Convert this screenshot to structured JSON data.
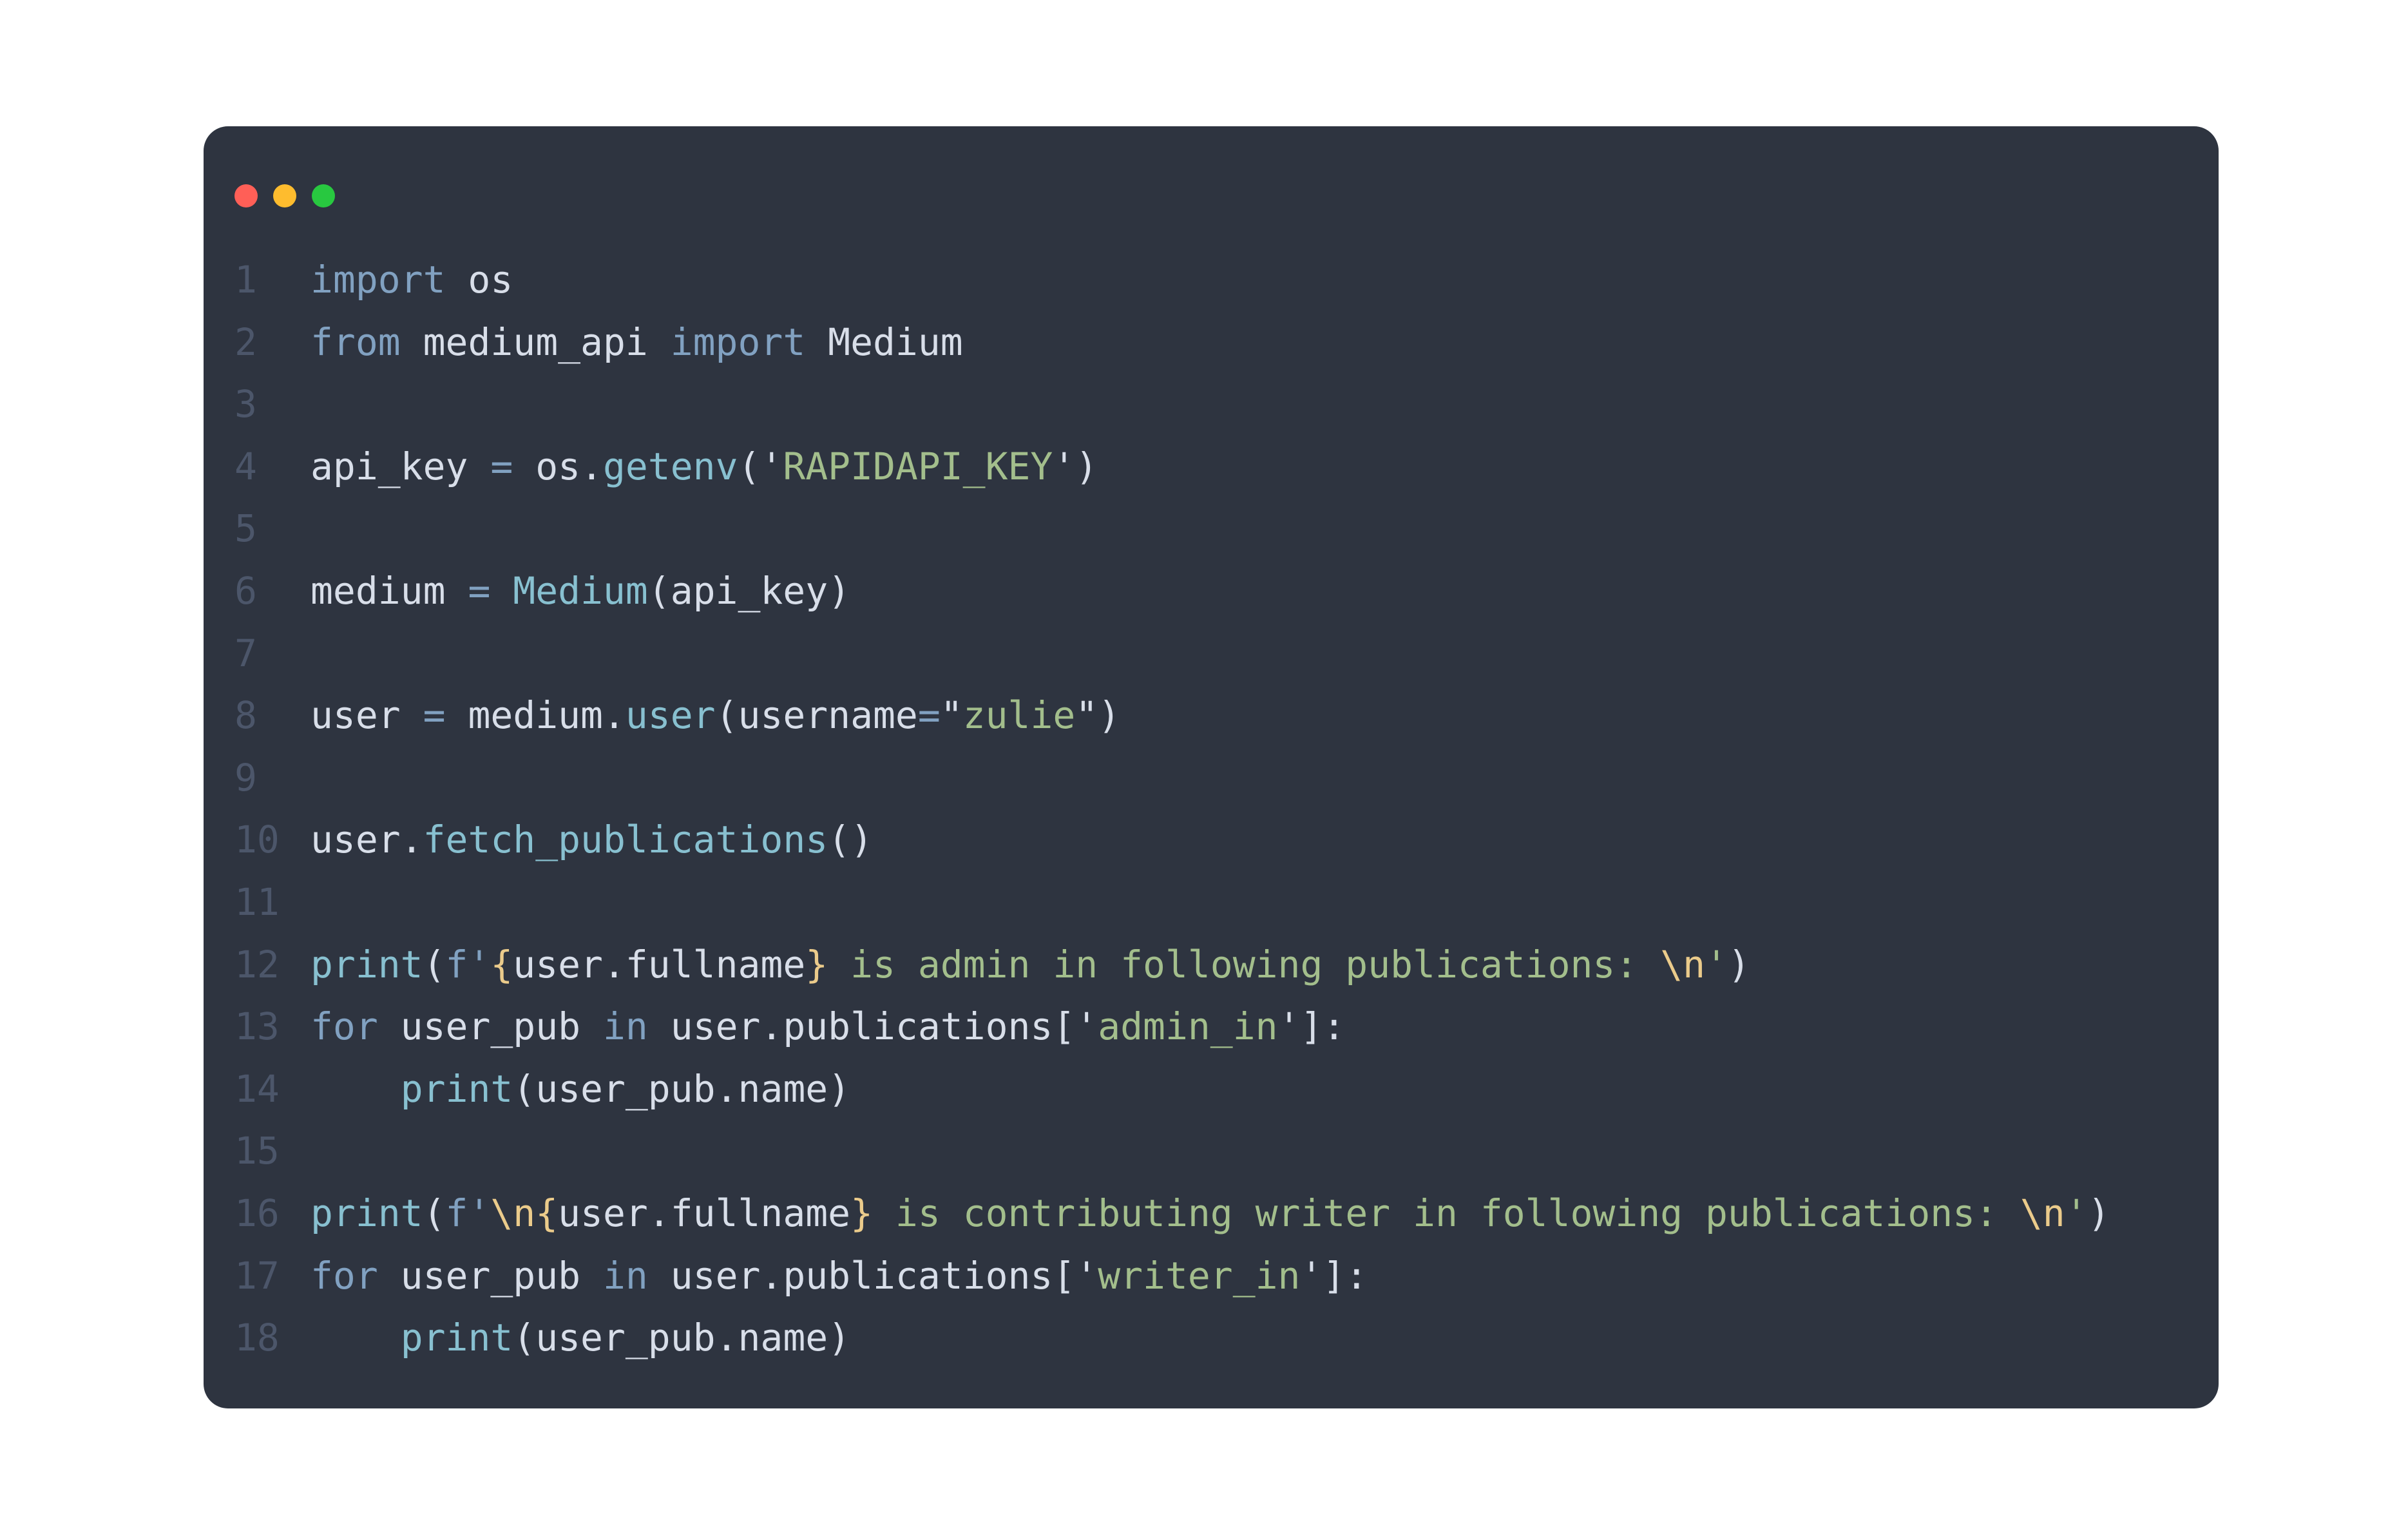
{
  "window": {
    "controls": [
      {
        "name": "close-dot",
        "color": "#ff5f57"
      },
      {
        "name": "minimize-dot",
        "color": "#febc2e"
      },
      {
        "name": "maximize-dot",
        "color": "#28c840"
      }
    ]
  },
  "code": {
    "language": "python",
    "colors": {
      "background": "#2e3440",
      "keyword": "#81a1c1",
      "function": "#88c0d0",
      "string": "#a3be8c",
      "escape": "#ebcb8b",
      "plain": "#d8dee9",
      "line_number": "#4c566a"
    },
    "lines": [
      {
        "number": "1",
        "tokens": [
          {
            "t": "kw",
            "v": "import"
          },
          {
            "t": "plain",
            "v": " os"
          }
        ]
      },
      {
        "number": "2",
        "tokens": [
          {
            "t": "kw",
            "v": "from"
          },
          {
            "t": "plain",
            "v": " medium_api "
          },
          {
            "t": "kw",
            "v": "import"
          },
          {
            "t": "plain",
            "v": " Medium"
          }
        ]
      },
      {
        "number": "3",
        "tokens": []
      },
      {
        "number": "4",
        "tokens": [
          {
            "t": "plain",
            "v": "api_key "
          },
          {
            "t": "op",
            "v": "="
          },
          {
            "t": "plain",
            "v": " os."
          },
          {
            "t": "fn",
            "v": "getenv"
          },
          {
            "t": "plain",
            "v": "('"
          },
          {
            "t": "str",
            "v": "RAPIDAPI_KEY"
          },
          {
            "t": "plain",
            "v": "')"
          }
        ]
      },
      {
        "number": "5",
        "tokens": []
      },
      {
        "number": "6",
        "tokens": [
          {
            "t": "plain",
            "v": "medium "
          },
          {
            "t": "op",
            "v": "="
          },
          {
            "t": "plain",
            "v": " "
          },
          {
            "t": "fn",
            "v": "Medium"
          },
          {
            "t": "plain",
            "v": "(api_key)"
          }
        ]
      },
      {
        "number": "7",
        "tokens": []
      },
      {
        "number": "8",
        "tokens": [
          {
            "t": "plain",
            "v": "user "
          },
          {
            "t": "op",
            "v": "="
          },
          {
            "t": "plain",
            "v": " medium."
          },
          {
            "t": "fn",
            "v": "user"
          },
          {
            "t": "plain",
            "v": "(username"
          },
          {
            "t": "op",
            "v": "="
          },
          {
            "t": "plain",
            "v": "\""
          },
          {
            "t": "str",
            "v": "zulie"
          },
          {
            "t": "plain",
            "v": "\")"
          }
        ]
      },
      {
        "number": "9",
        "tokens": []
      },
      {
        "number": "10",
        "tokens": [
          {
            "t": "plain",
            "v": "user."
          },
          {
            "t": "fn",
            "v": "fetch_publications"
          },
          {
            "t": "plain",
            "v": "()"
          }
        ]
      },
      {
        "number": "11",
        "tokens": []
      },
      {
        "number": "12",
        "tokens": [
          {
            "t": "fn",
            "v": "print"
          },
          {
            "t": "plain",
            "v": "("
          },
          {
            "t": "kw",
            "v": "f'"
          },
          {
            "t": "brace",
            "v": "{"
          },
          {
            "t": "plain",
            "v": "user.fullname"
          },
          {
            "t": "brace",
            "v": "}"
          },
          {
            "t": "str",
            "v": " is admin in following publications: "
          },
          {
            "t": "esc",
            "v": "\\n"
          },
          {
            "t": "str",
            "v": "'"
          },
          {
            "t": "plain",
            "v": ")"
          }
        ]
      },
      {
        "number": "13",
        "tokens": [
          {
            "t": "kw",
            "v": "for"
          },
          {
            "t": "plain",
            "v": " user_pub "
          },
          {
            "t": "kw",
            "v": "in"
          },
          {
            "t": "plain",
            "v": " user.publications['"
          },
          {
            "t": "str",
            "v": "admin_in"
          },
          {
            "t": "plain",
            "v": "']:"
          }
        ]
      },
      {
        "number": "14",
        "tokens": [
          {
            "t": "plain",
            "v": "    "
          },
          {
            "t": "fn",
            "v": "print"
          },
          {
            "t": "plain",
            "v": "(user_pub.name)"
          }
        ]
      },
      {
        "number": "15",
        "tokens": []
      },
      {
        "number": "16",
        "tokens": [
          {
            "t": "fn",
            "v": "print"
          },
          {
            "t": "plain",
            "v": "("
          },
          {
            "t": "kw",
            "v": "f'"
          },
          {
            "t": "esc",
            "v": "\\n"
          },
          {
            "t": "brace",
            "v": "{"
          },
          {
            "t": "plain",
            "v": "user.fullname"
          },
          {
            "t": "brace",
            "v": "}"
          },
          {
            "t": "str",
            "v": " is contributing writer in following publications: "
          },
          {
            "t": "esc",
            "v": "\\n"
          },
          {
            "t": "str",
            "v": "'"
          },
          {
            "t": "plain",
            "v": ")"
          }
        ]
      },
      {
        "number": "17",
        "tokens": [
          {
            "t": "kw",
            "v": "for"
          },
          {
            "t": "plain",
            "v": " user_pub "
          },
          {
            "t": "kw",
            "v": "in"
          },
          {
            "t": "plain",
            "v": " user.publications['"
          },
          {
            "t": "str",
            "v": "writer_in"
          },
          {
            "t": "plain",
            "v": "']:"
          }
        ]
      },
      {
        "number": "18",
        "tokens": [
          {
            "t": "plain",
            "v": "    "
          },
          {
            "t": "fn",
            "v": "print"
          },
          {
            "t": "plain",
            "v": "(user_pub.name)"
          }
        ]
      }
    ]
  }
}
